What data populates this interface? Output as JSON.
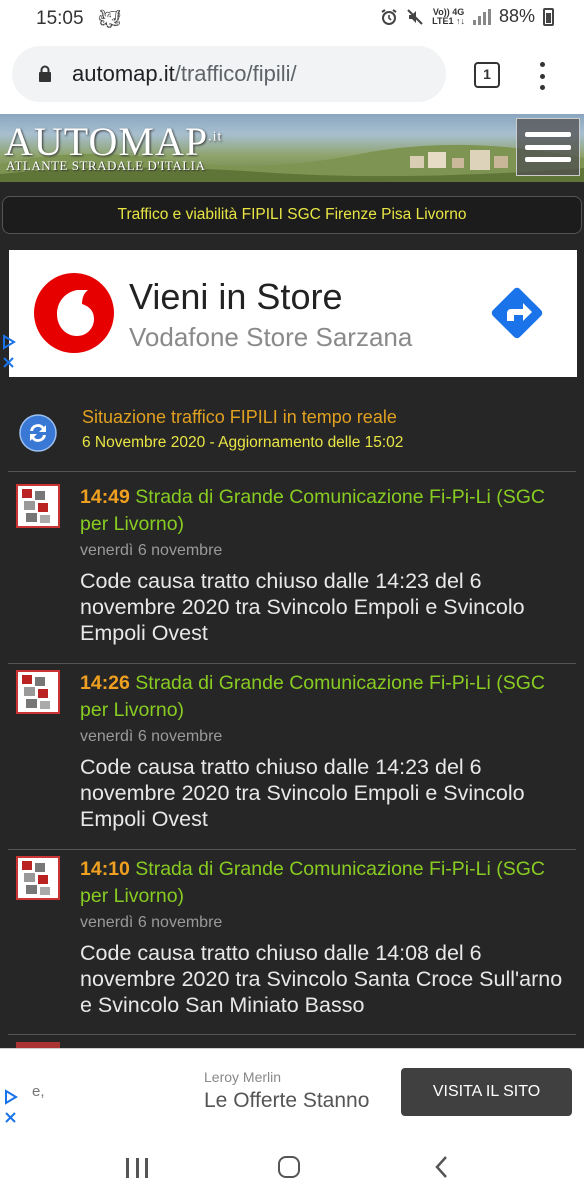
{
  "status_bar": {
    "time": "15:05",
    "network_top": "Vo)) 4G",
    "network_bottom": "LTE1 ↑↓",
    "battery": "88%"
  },
  "browser": {
    "url_domain": "automap.it",
    "url_path": "/traffico/fipili/",
    "tab_count": "1"
  },
  "site": {
    "logo_main": "AUTOMAP",
    "logo_suffix": ".it",
    "logo_tagline": "ATLANTE STRADALE D'ITALIA",
    "page_title": "Traffico e viabilità FIPILI SGC Firenze Pisa Livorno"
  },
  "ad_top": {
    "title": "Vieni in Store",
    "subtitle": "Vodafone Store Sarzana",
    "brand_color": "#e60000",
    "arrow_color": "#1a73e8"
  },
  "traffic": {
    "heading": "Situazione traffico FIPILI in tempo reale",
    "date_line": "6 Novembre 2020 - Aggiornamento delle 15:02",
    "entries": [
      {
        "time": "14:49",
        "road": "Strada di Grande Comunicazione Fi-Pi-Li (SGC per Livorno)",
        "day": "venerdì 6 novembre",
        "text": "Code causa tratto chiuso dalle 14:23 del 6 novembre 2020 tra Svincolo Empoli e Svincolo Empoli Ovest"
      },
      {
        "time": "14:26",
        "road": "Strada di Grande Comunicazione Fi-Pi-Li (SGC per Livorno)",
        "day": "venerdì 6 novembre",
        "text": "Code causa tratto chiuso dalle 14:23 del 6 novembre 2020 tra Svincolo Empoli e Svincolo Empoli Ovest"
      },
      {
        "time": "14:10",
        "road": "Strada di Grande Comunicazione Fi-Pi-Li (SGC per Livorno)",
        "day": "venerdì 6 novembre",
        "text": "Code causa tratto chiuso dalle 14:08 del 6 novembre 2020 tra Svincolo Santa Croce Sull'arno e Svincolo San Miniato Basso"
      }
    ]
  },
  "ad_bottom": {
    "fragment": "e,",
    "brand": "Leroy Merlin",
    "title": "Le Offerte Stanno",
    "button": "VISITA IL SITO"
  }
}
